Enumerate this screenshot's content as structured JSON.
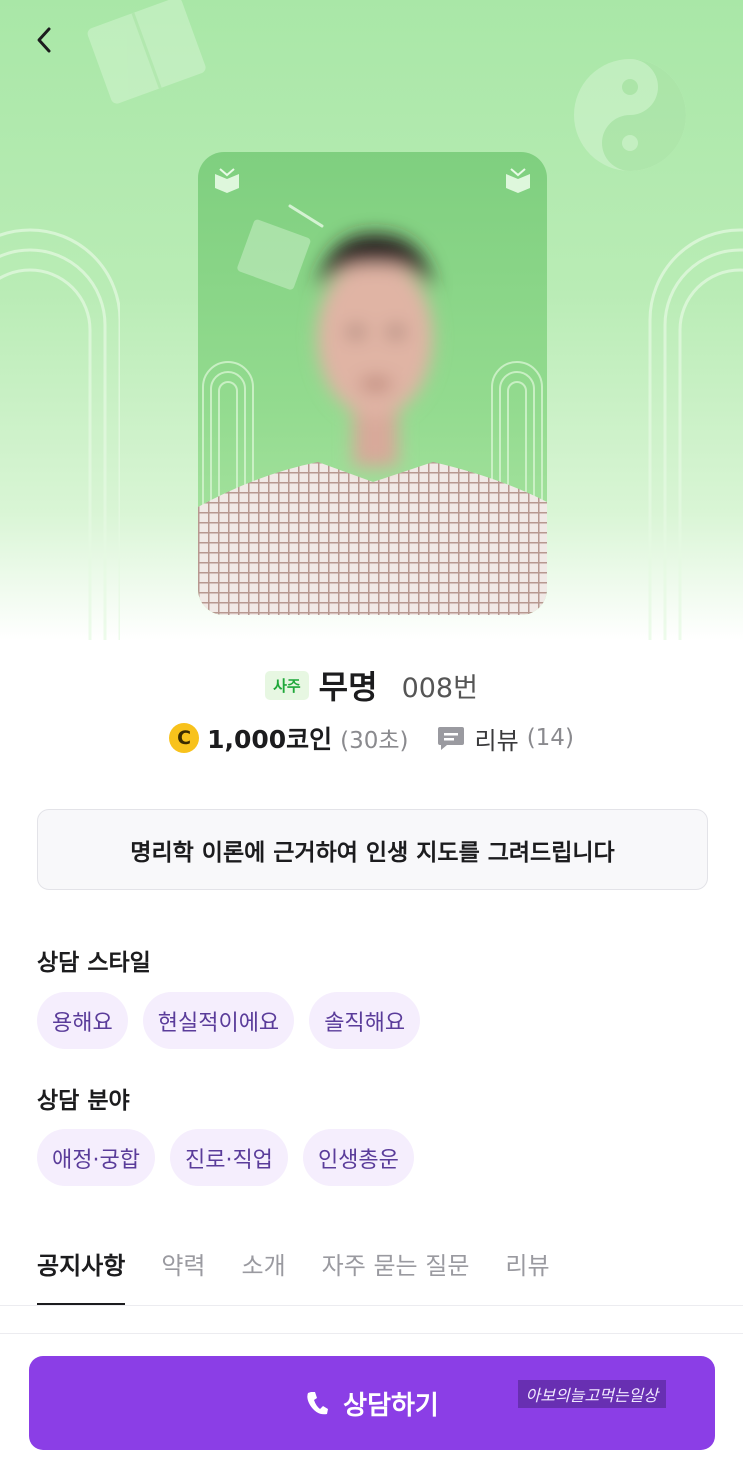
{
  "header": {
    "back_icon": "chevron-left-icon"
  },
  "profile": {
    "category_badge": "사주",
    "name": "무명",
    "number": "008번",
    "price": "1,000코인",
    "coin_symbol": "C",
    "duration": "(30초)",
    "review_label": "리뷰",
    "review_count": "(14)",
    "intro": "명리학 이론에 근거하여 인생 지도를 그려드립니다"
  },
  "style_section": {
    "title": "상담 스타일",
    "chips": [
      "용해요",
      "현실적이에요",
      "솔직해요"
    ]
  },
  "field_section": {
    "title": "상담 분야",
    "chips": [
      "애정·궁합",
      "진로·직업",
      "인생총운"
    ]
  },
  "tabs": [
    {
      "label": "공지사항",
      "active": true
    },
    {
      "label": "약력",
      "active": false
    },
    {
      "label": "소개",
      "active": false
    },
    {
      "label": "자주 묻는 질문",
      "active": false
    },
    {
      "label": "리뷰",
      "active": false
    }
  ],
  "cta": {
    "label": "상담하기",
    "icon": "phone-icon"
  },
  "watermark": "아보의늘고먹는일상",
  "colors": {
    "primary": "#8b3ee6",
    "hero_green": "#a9e7a7",
    "badge_green": "#1fa83a",
    "chip_bg": "#f5eefd",
    "chip_text": "#5a3c9a",
    "coin": "#f8c21c"
  }
}
